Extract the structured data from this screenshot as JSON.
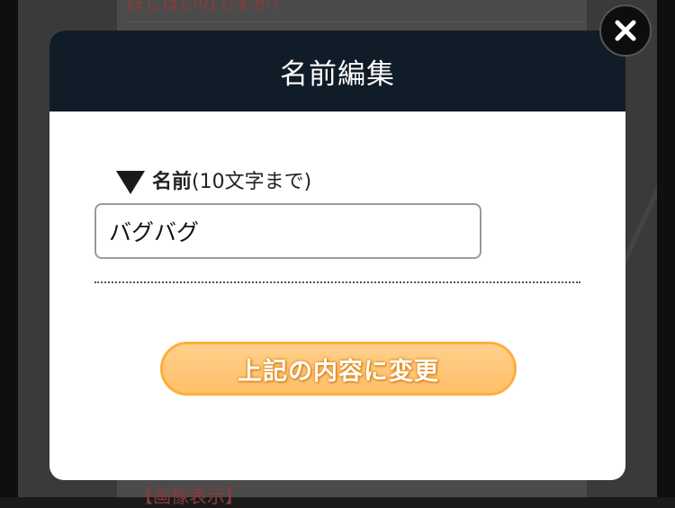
{
  "background": {
    "top_text": "詳しはいのですが？",
    "bottom_text": "【画像表示】"
  },
  "modal": {
    "title": "名前編集",
    "field": {
      "label_strong": "名前",
      "label_note": "(10文字まで)",
      "value": "バグバグ"
    },
    "submit_label": "上記の内容に変更"
  },
  "icons": {
    "close": "close-icon",
    "field_marker": "triangle-down-icon"
  },
  "colors": {
    "header_bg": "#111c29",
    "button_fill": "#ffc06a",
    "button_border": "#ffae3a"
  }
}
